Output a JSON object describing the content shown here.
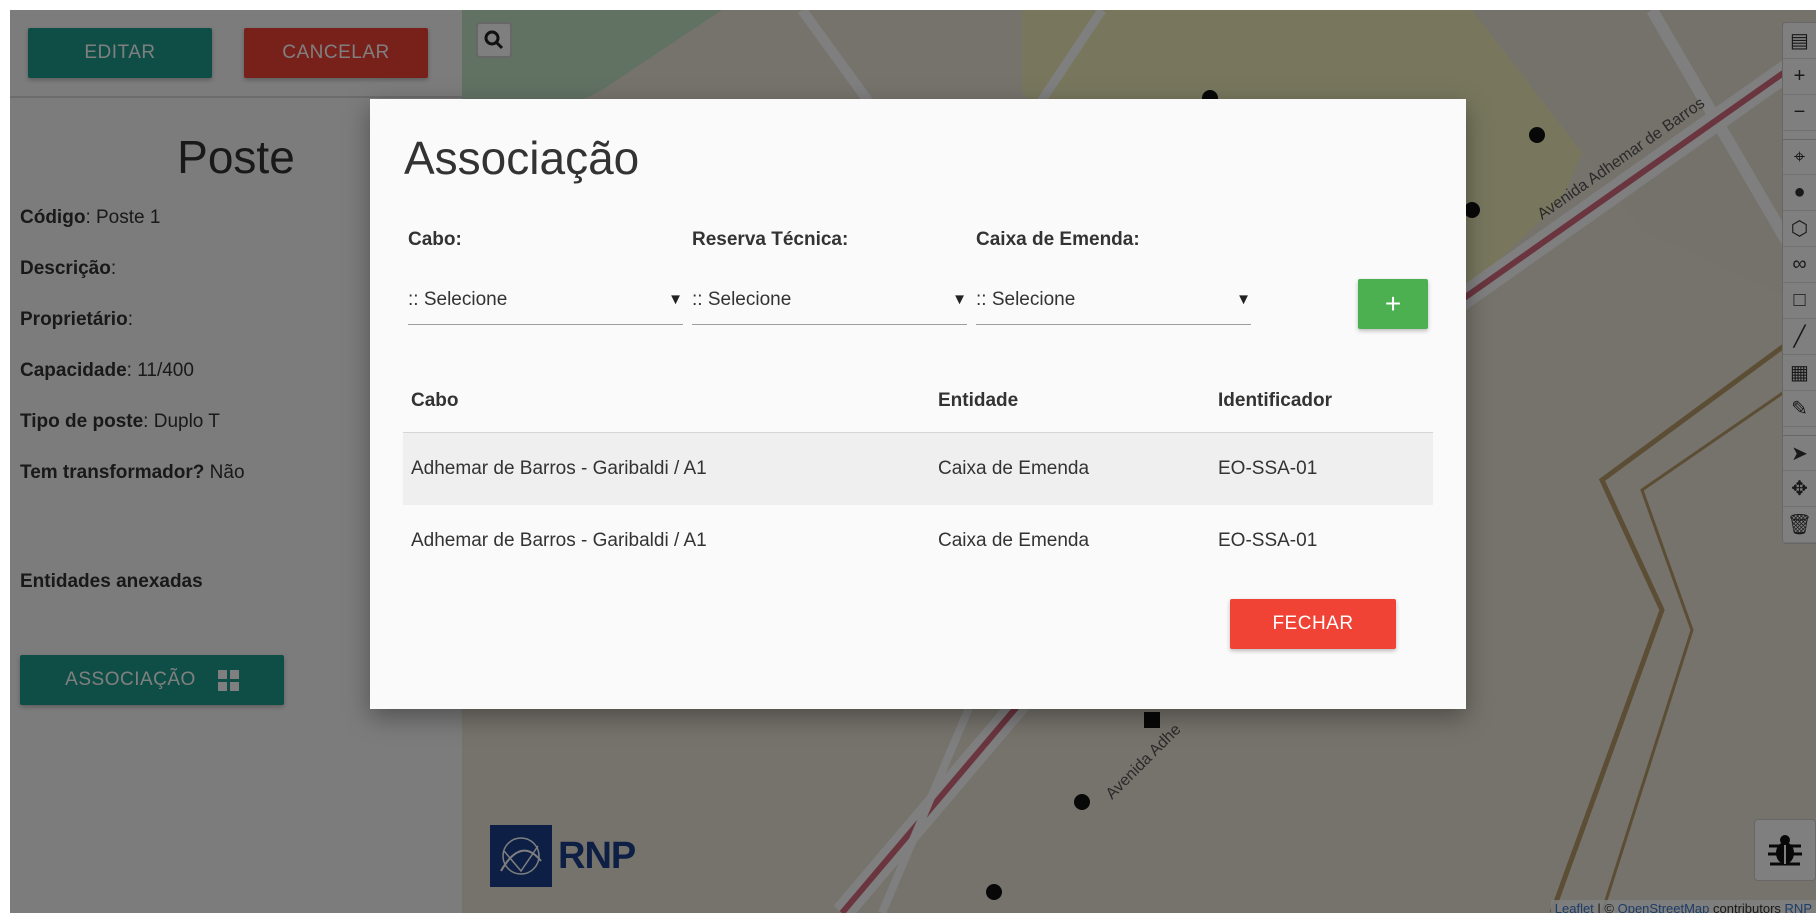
{
  "panel": {
    "edit_label": "EDITAR",
    "cancel_label": "CANCELAR",
    "title": "Poste",
    "fields": [
      {
        "label": "Código",
        "sep": ":",
        "value": " Poste 1"
      },
      {
        "label": "Descrição",
        "sep": ":",
        "value": ""
      },
      {
        "label": "Proprietário",
        "sep": ":",
        "value": ""
      },
      {
        "label": "Capacidade",
        "sep": ":",
        "value": " 11/400"
      },
      {
        "label": "Tipo de poste",
        "sep": ":",
        "value": " Duplo T"
      },
      {
        "label": "Tem transformador?",
        "sep": "",
        "value": " Não"
      }
    ],
    "attached_label": "Entidades anexadas",
    "assoc_label": "ASSOCIAÇÃO",
    "assoc_icon": "grid-icon"
  },
  "map": {
    "search_icon": "search-icon",
    "street_name": "Avenida Adhemar de Barros",
    "street_name_lower": "Avenida Adhe",
    "logo_text": "RNP",
    "attribution": {
      "leaflet": "Leaflet",
      "sep": " | © ",
      "osm": "OpenStreetMap",
      "contributors": " contributors ",
      "rnp": "RNP"
    },
    "tools": [
      "layers-icon",
      "zoom-in-icon",
      "zoom-out-icon",
      "locate-icon",
      "marker-icon",
      "polygon-icon",
      "infinity-icon",
      "rectangle-icon",
      "line-icon",
      "note-icon",
      "ruler-icon",
      "pointer-icon",
      "move-icon",
      "trash-icon"
    ],
    "bug_icon": "bug-icon"
  },
  "modal": {
    "title": "Associação",
    "filters": [
      {
        "label": "Cabo:",
        "value": ":: Selecione"
      },
      {
        "label": "Reserva Técnica:",
        "value": ":: Selecione"
      },
      {
        "label": "Caixa de Emenda:",
        "value": ":: Selecione"
      }
    ],
    "add_label": "+",
    "columns": [
      "Cabo",
      "Entidade",
      "Identificador"
    ],
    "rows": [
      {
        "cabo": "Adhemar de Barros - Garibaldi / A1",
        "entidade": "Caixa de Emenda",
        "identificador": "EO-SSA-01"
      },
      {
        "cabo": "Adhemar de Barros - Garibaldi / A1",
        "entidade": "Caixa de Emenda",
        "identificador": "EO-SSA-01"
      }
    ],
    "close_label": "FECHAR"
  },
  "colors": {
    "teal": "#1f9c8c",
    "red": "#f04336",
    "green": "#4caf50",
    "rnp_blue": "#1c3f8a"
  }
}
